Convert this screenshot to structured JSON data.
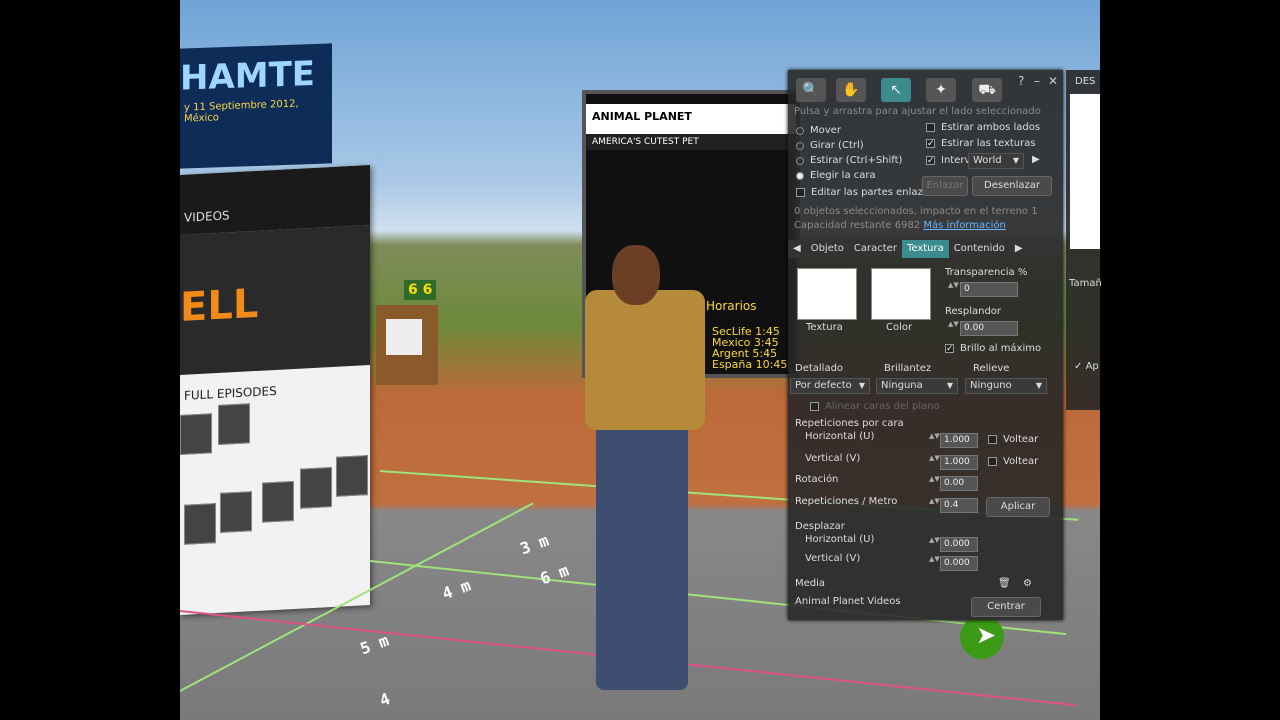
{
  "scene": {
    "amte_title": "HAMTE",
    "amte_date": "y 11 Septiembre 2012, México",
    "videos_label": "VIDEOS",
    "episodes_label": "FULL EPISODES",
    "hero_logo": "ELL",
    "sign_text": "6 6",
    "tv_brand": "ANIMAL PLANET",
    "tv_subtitle": "AMERICA'S CUTEST PET",
    "tv_horarios": "Horarios",
    "tv_times": [
      "SecLife 1:45",
      "Mexico 3:45",
      "Argent 5:45",
      "España 10:45"
    ],
    "floor_marks": [
      "3 m",
      "4 m",
      "5 m",
      "6 m",
      "4"
    ]
  },
  "floater": {
    "tools": [
      {
        "name": "zoom-tool",
        "icon": "magnifier-icon",
        "glyph": "🔍"
      },
      {
        "name": "grab-tool",
        "icon": "hand-icon",
        "glyph": "✋"
      },
      {
        "name": "edit-tool",
        "icon": "pointer-icon",
        "glyph": "↖"
      },
      {
        "name": "create-tool",
        "icon": "wand-icon",
        "glyph": "✦"
      },
      {
        "name": "land-tool",
        "icon": "bulldozer-icon",
        "glyph": "⛟"
      }
    ],
    "help_glyph": "?",
    "minimize_glyph": "–",
    "close_glyph": "✕",
    "hint": "Pulsa y arrastra para ajustar el lado seleccionado",
    "modes": [
      {
        "label": "Mover",
        "selected": false
      },
      {
        "label": "Girar (Ctrl)",
        "selected": false
      },
      {
        "label": "Estirar (Ctrl+Shift)",
        "selected": false
      },
      {
        "label": "Elegir la cara",
        "selected": true
      }
    ],
    "edit_linked": "Editar las partes enlazadas",
    "stretch_both": "Estirar ambos lados",
    "stretch_textures": "Estirar las texturas",
    "interval_label": "Interv",
    "world_select": "World",
    "link_button": "Enlazar",
    "unlink_button": "Desenlazar",
    "info_selected": "0 objetos seleccionados, impacto en el terreno 1",
    "info_capacity": "Capacidad restante 6982",
    "more_info": "Más información",
    "tabs": [
      "Objeto",
      "Caracter",
      "Textura",
      "Contenido"
    ],
    "selected_tab": "Textura",
    "texture_label": "Textura",
    "color_label": "Color",
    "transparency_label": "Transparencia %",
    "transparency_value": "0",
    "glow_label": "Resplandor",
    "glow_value": "0.00",
    "fullbright_label": "Brillo al máximo",
    "detail_label": "Detallado",
    "shininess_label": "Brillantez",
    "bump_label": "Relieve",
    "detail_value": "Por defecto",
    "shininess_value": "Ninguna",
    "bump_value": "Ninguno",
    "align_planar": "Alinear caras del plano",
    "repeats_label": "Repeticiones por cara",
    "horizontal_u": "Horizontal (U)",
    "vertical_v": "Vertical (V)",
    "repeat_u_value": "1.000",
    "repeat_v_value": "1.000",
    "flip_label": "Voltear",
    "rotation_label": "Rotación",
    "rotation_value": "0.00",
    "repeats_per_meter_label": "Repeticiones / Metro",
    "repeats_per_meter_value": "0.4",
    "apply_button": "Aplicar",
    "offset_label": "Desplazar",
    "offset_u_value": "0.000",
    "offset_v_value": "0.000",
    "media_label": "Media",
    "media_name": "Animal Planet Videos",
    "center_button": "Centrar"
  },
  "right_floater": {
    "title": "DES",
    "size_label": "Tamañ",
    "apply_abbrev": "Ap"
  }
}
